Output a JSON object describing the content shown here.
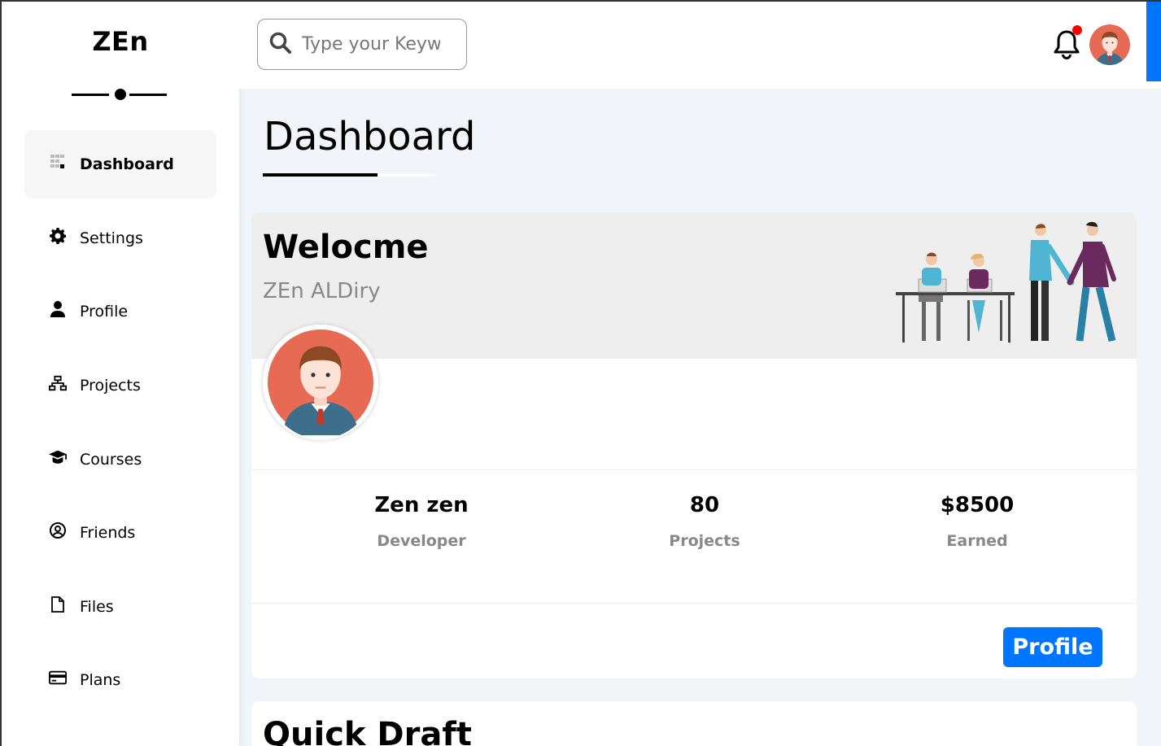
{
  "brand": {
    "name": "ZEn"
  },
  "sidebar": {
    "items": [
      {
        "label": "Dashboard",
        "icon": "dashboard-grid-icon",
        "active": true
      },
      {
        "label": "Settings",
        "icon": "gear-icon"
      },
      {
        "label": "Profile",
        "icon": "user-icon"
      },
      {
        "label": "Projects",
        "icon": "sitemap-icon"
      },
      {
        "label": "Courses",
        "icon": "graduation-cap-icon"
      },
      {
        "label": "Friends",
        "icon": "user-circle-icon"
      },
      {
        "label": "Files",
        "icon": "file-icon"
      },
      {
        "label": "Plans",
        "icon": "credit-card-icon"
      }
    ]
  },
  "header": {
    "search": {
      "placeholder": "Type your Keyword"
    },
    "notification_dot": true
  },
  "page": {
    "title": "Dashboard"
  },
  "welcome": {
    "title": "Welocme",
    "name": "ZEn ALDiry",
    "stats": [
      {
        "value": "Zen zen",
        "label": "Developer"
      },
      {
        "value": "80",
        "label": "Projects"
      },
      {
        "value": "$8500",
        "label": "Earned"
      }
    ],
    "button_label": "Profile"
  },
  "quick_draft": {
    "title": "Quick Draft"
  },
  "colors": {
    "accent": "#0075ff",
    "alert": "#ff0000",
    "avatar_bg": "#e76a55"
  }
}
